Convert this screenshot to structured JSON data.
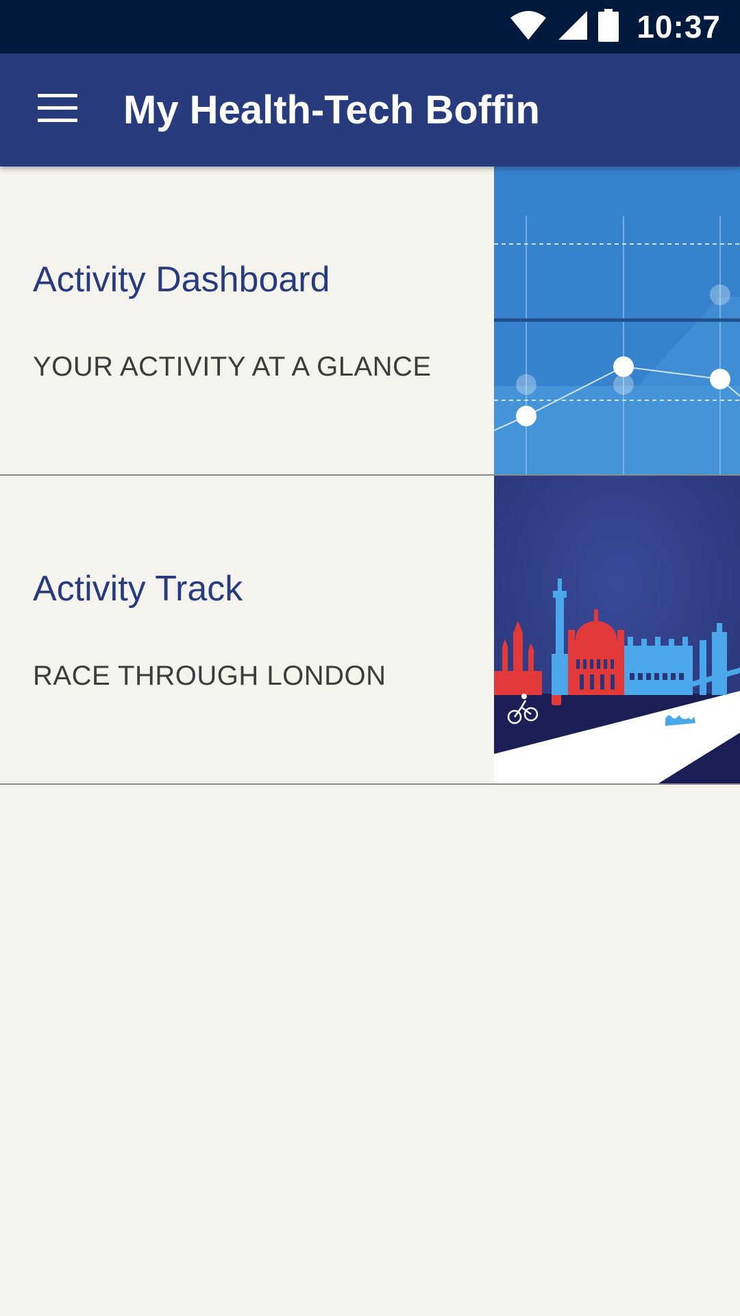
{
  "status_bar": {
    "time": "10:37",
    "icons": [
      "wifi-icon",
      "cell-signal-icon",
      "battery-icon"
    ]
  },
  "app_bar": {
    "title": "My Health-Tech Boffin",
    "menu_icon": "hamburger-menu-icon"
  },
  "cards": [
    {
      "title": "Activity Dashboard",
      "subtitle": "YOUR ACTIVITY AT A GLANCE",
      "image": "activity-chart-illustration"
    },
    {
      "title": "Activity Track",
      "subtitle": "RACE THROUGH LONDON",
      "image": "london-skyline-illustration"
    }
  ],
  "colors": {
    "status_bar": "#011a3d",
    "app_bar": "#283b7d",
    "background": "#f4f3ee",
    "title_text": "#283b7d",
    "subtitle_text": "#3c3c3c",
    "chart_blue": "#3a86cf",
    "skyline_red": "#e23a3a",
    "skyline_blue": "#4aa8ea"
  }
}
